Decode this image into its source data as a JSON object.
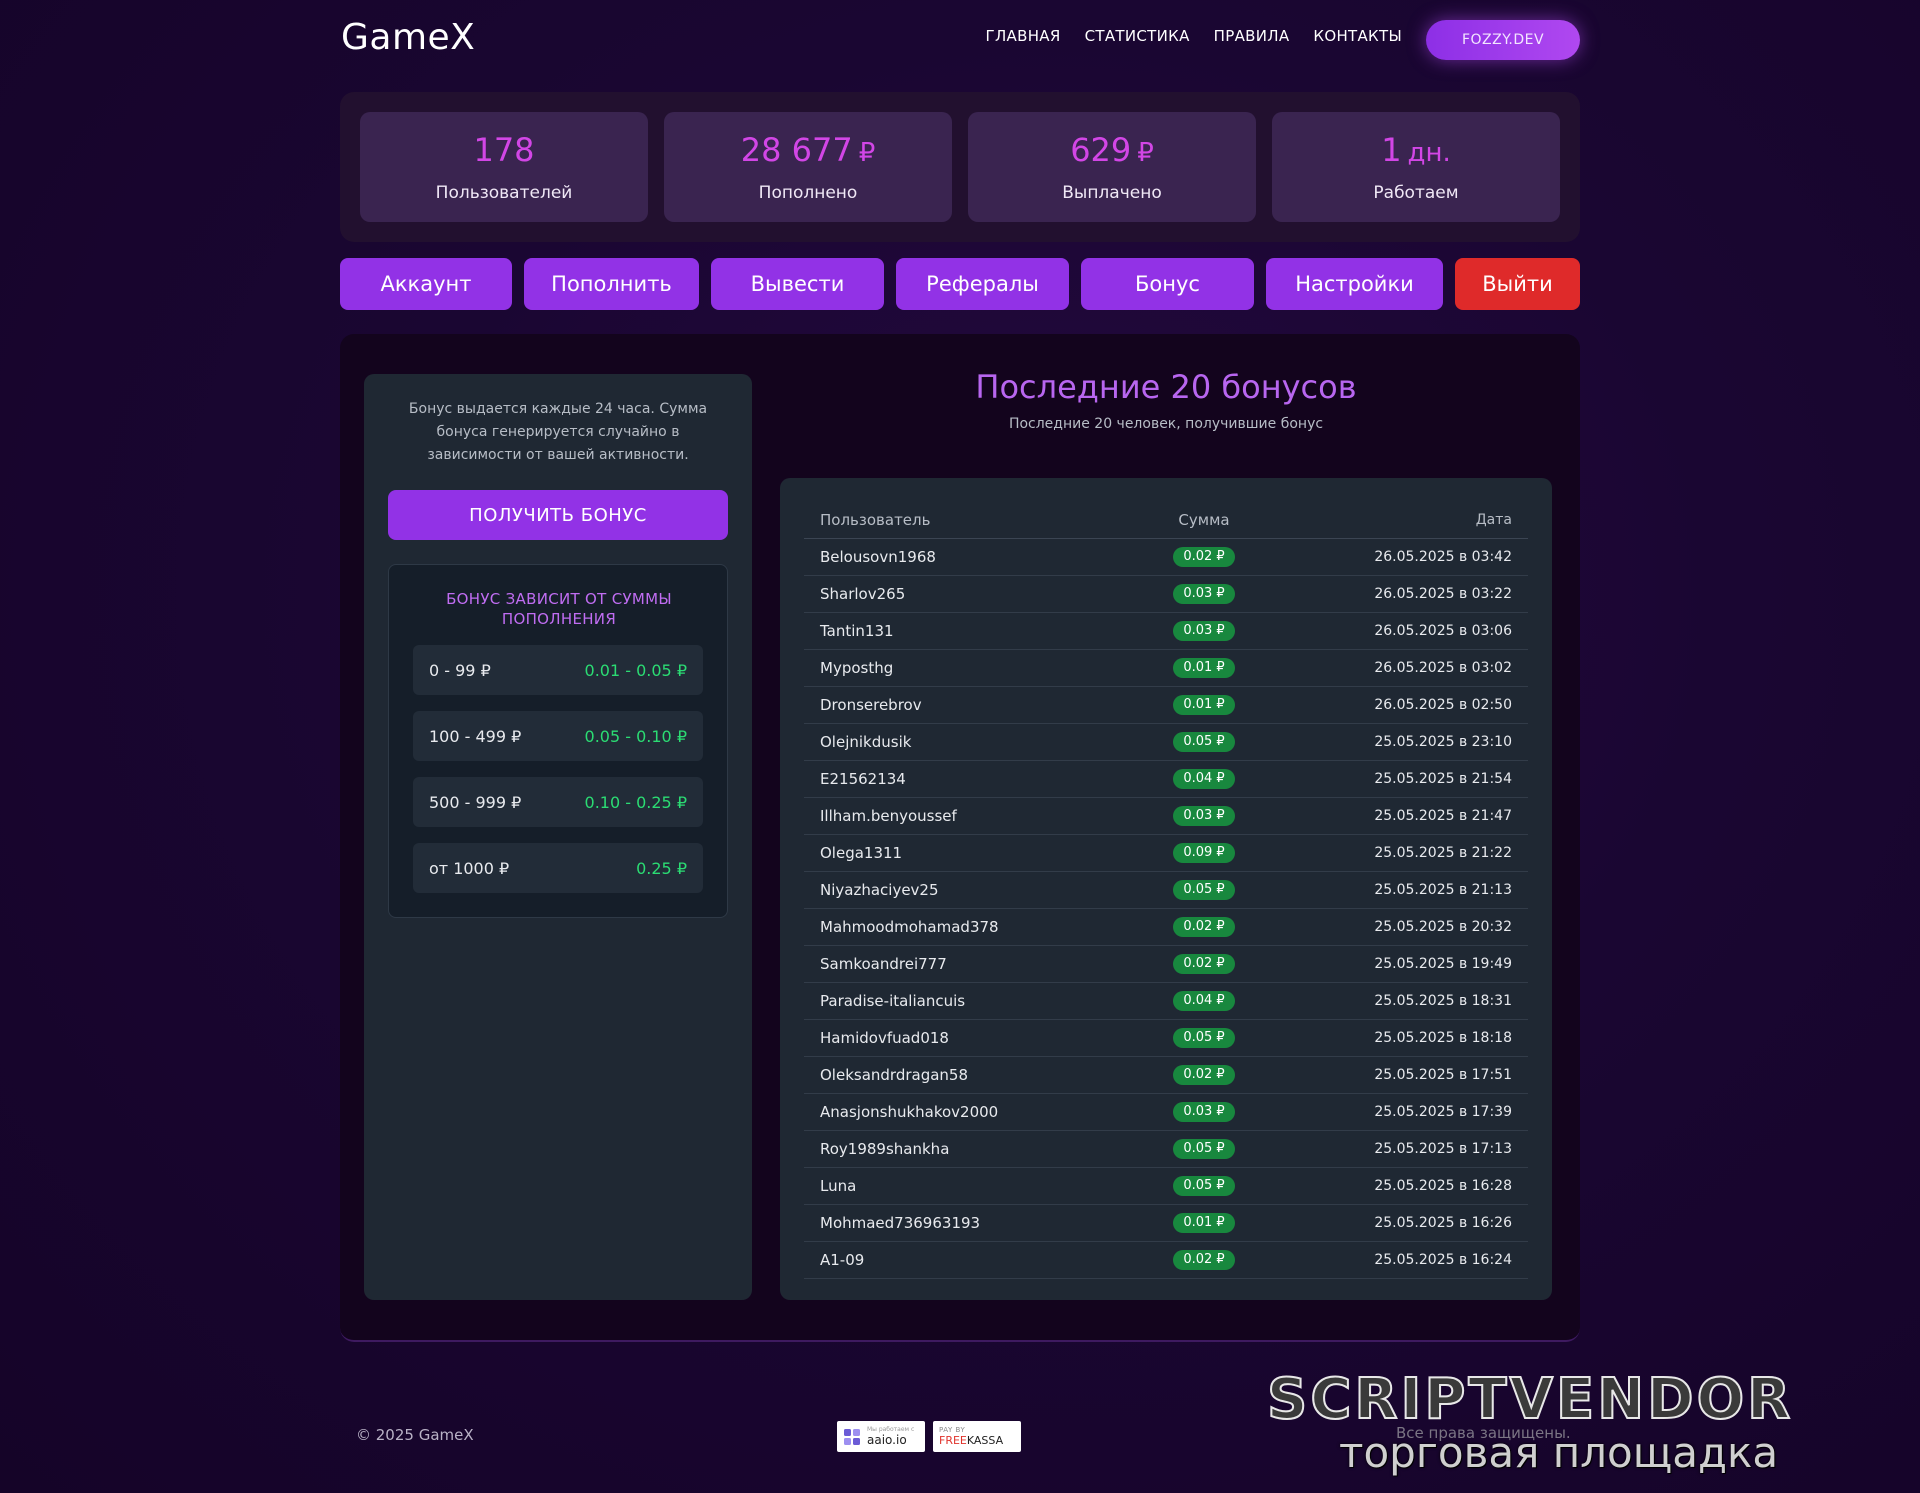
{
  "header": {
    "logo": "GameX",
    "nav": [
      "ГЛАВНАЯ",
      "СТАТИСТИКА",
      "ПРАВИЛА",
      "КОНТАКТЫ"
    ],
    "user_button": "FOZZY.DEV"
  },
  "stats": [
    {
      "value": "178",
      "unit": "",
      "label": "Пользователей"
    },
    {
      "value": "28 677",
      "unit": "₽",
      "label": "Пополнено"
    },
    {
      "value": "629",
      "unit": "₽",
      "label": "Выплачено"
    },
    {
      "value": "1",
      "unit": "дн.",
      "label": "Работаем"
    }
  ],
  "tabs": [
    "Аккаунт",
    "Пополнить",
    "Вывести",
    "Рефералы",
    "Бонус",
    "Настройки",
    "Выйти"
  ],
  "bonus": {
    "description": "Бонус выдается каждые 24 часа. Сумма бонуса генерируется случайно в зависимости от вашей активности.",
    "button": "ПОЛУЧИТЬ БОНУС",
    "tiers_title": "БОНУС ЗАВИСИТ ОТ СУММЫ ПОПОЛНЕНИЯ",
    "tiers": [
      {
        "range": "0 - 99 ₽",
        "amount": "0.01 - 0.05 ₽"
      },
      {
        "range": "100 - 499 ₽",
        "amount": "0.05 - 0.10 ₽"
      },
      {
        "range": "500 - 999 ₽",
        "amount": "0.10 - 0.25 ₽"
      },
      {
        "range": "от 1000 ₽",
        "amount": "0.25 ₽"
      }
    ]
  },
  "recent": {
    "title": "Последние 20 бонусов",
    "subtitle": "Последние 20 человек, получившие бонус",
    "columns": [
      "Пользователь",
      "Сумма",
      "Дата"
    ],
    "rows": [
      {
        "user": "Belousovn1968",
        "sum": "0.02 ₽",
        "date": "26.05.2025 в 03:42"
      },
      {
        "user": "Sharlov265",
        "sum": "0.03 ₽",
        "date": "26.05.2025 в 03:22"
      },
      {
        "user": "Tantin131",
        "sum": "0.03 ₽",
        "date": "26.05.2025 в 03:06"
      },
      {
        "user": "Myposthg",
        "sum": "0.01 ₽",
        "date": "26.05.2025 в 03:02"
      },
      {
        "user": "Dronserebrov",
        "sum": "0.01 ₽",
        "date": "26.05.2025 в 02:50"
      },
      {
        "user": "Olejnikdusik",
        "sum": "0.05 ₽",
        "date": "25.05.2025 в 23:10"
      },
      {
        "user": "E21562134",
        "sum": "0.04 ₽",
        "date": "25.05.2025 в 21:54"
      },
      {
        "user": "Illham.benyoussef",
        "sum": "0.03 ₽",
        "date": "25.05.2025 в 21:47"
      },
      {
        "user": "Olega1311",
        "sum": "0.09 ₽",
        "date": "25.05.2025 в 21:22"
      },
      {
        "user": "Niyazhaciyev25",
        "sum": "0.05 ₽",
        "date": "25.05.2025 в 21:13"
      },
      {
        "user": "Mahmoodmohamad378",
        "sum": "0.02 ₽",
        "date": "25.05.2025 в 20:32"
      },
      {
        "user": "Samkoandrei777",
        "sum": "0.02 ₽",
        "date": "25.05.2025 в 19:49"
      },
      {
        "user": "Paradise-italiancuis",
        "sum": "0.04 ₽",
        "date": "25.05.2025 в 18:31"
      },
      {
        "user": "Hamidovfuad018",
        "sum": "0.05 ₽",
        "date": "25.05.2025 в 18:18"
      },
      {
        "user": "Oleksandrdragan58",
        "sum": "0.02 ₽",
        "date": "25.05.2025 в 17:51"
      },
      {
        "user": "Anasjonshukhakov2000",
        "sum": "0.03 ₽",
        "date": "25.05.2025 в 17:39"
      },
      {
        "user": "Roy1989shankha",
        "sum": "0.05 ₽",
        "date": "25.05.2025 в 17:13"
      },
      {
        "user": "Luna",
        "sum": "0.05 ₽",
        "date": "25.05.2025 в 16:28"
      },
      {
        "user": "Mohmaed736963193",
        "sum": "0.01 ₽",
        "date": "25.05.2025 в 16:26"
      },
      {
        "user": "A1-09",
        "sum": "0.02 ₽",
        "date": "25.05.2025 в 16:24"
      }
    ]
  },
  "footer": {
    "copyright": "© 2025 GameX",
    "aaio_small": "Мы работаем с",
    "aaio": "aaio.io",
    "freekassa_small": "PAY BY",
    "freekassa_free": "FREE",
    "freekassa_kassa": "KASSA",
    "rights": "Все права защищены."
  },
  "watermark": {
    "main": "SCRIPTVENDOR",
    "sub": "торговая площадка"
  },
  "colors": {
    "accent": "#9232e6",
    "stat_value": "#d246e6",
    "logout": "#df2a2a",
    "success": "#2bdc73",
    "pill": "#18883e"
  }
}
